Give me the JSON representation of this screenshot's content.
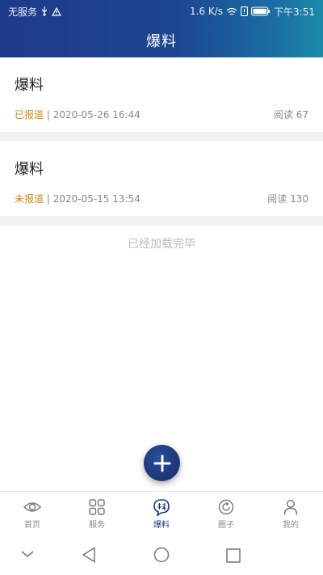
{
  "statusbar": {
    "carrier": "无服务",
    "speed": "1.6 K/s",
    "time": "下午3:51",
    "icons": [
      "usb-icon",
      "warning-icon",
      "wifi-icon",
      "sim-icon",
      "battery-icon"
    ]
  },
  "header": {
    "title": "爆料"
  },
  "items": [
    {
      "title": "爆料",
      "status": "已报道",
      "separator": " | ",
      "date": "2020-05-26 16:44",
      "reads": "阅读 67"
    },
    {
      "title": "爆料",
      "status": "未报道",
      "separator": " | ",
      "date": "2020-05-15 13:54",
      "reads": "阅读 130"
    }
  ],
  "end_text": "已经加载完毕",
  "fab": {
    "icon": "plus-icon"
  },
  "tabs": [
    {
      "label": "首页",
      "icon": "eye-icon"
    },
    {
      "label": "服务",
      "icon": "grid-icon"
    },
    {
      "label": "爆料",
      "icon": "tip-off-icon",
      "active": true
    },
    {
      "label": "圈子",
      "icon": "refresh-circle-icon"
    },
    {
      "label": "我的",
      "icon": "person-icon"
    }
  ],
  "colors": {
    "header_start": "#1e3a8a",
    "header_end": "#1a8aa8",
    "status_orange": "#d08a1c",
    "active_tab": "#1c3579",
    "muted_text": "#888888"
  }
}
